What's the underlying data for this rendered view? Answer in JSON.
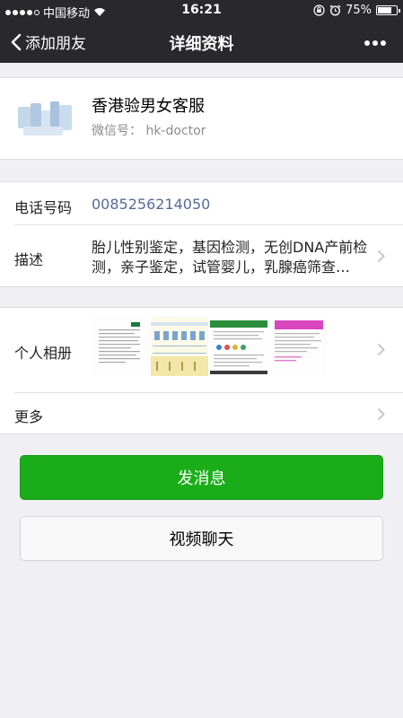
{
  "status_bar": {
    "carrier": "中国移动",
    "time": "16:21",
    "battery": "75%",
    "battery_level": 0.75
  },
  "nav": {
    "back_label": "添加朋友",
    "title": "详细资料",
    "more_icon": "more-dots-icon"
  },
  "profile": {
    "name": "香港验男女客服",
    "wechat_id": "微信号：  hk-doctor"
  },
  "info": {
    "phone_label": "电话号码",
    "phone_value": "0085256214050",
    "desc_label": "描述",
    "desc_value": "胎儿性别鉴定，基因检测，无创DNA产前检测，亲子鉴定，试管婴儿，乳腺癌筛查…"
  },
  "album": {
    "label": "个人相册",
    "more_label": "更多"
  },
  "buttons": {
    "send_message": "发消息",
    "video_chat": "视频聊天"
  },
  "colors": {
    "nav_bg": "#28282d",
    "accent_green": "#1aad19",
    "link_blue": "#576b95",
    "page_bg": "#efeff4"
  }
}
